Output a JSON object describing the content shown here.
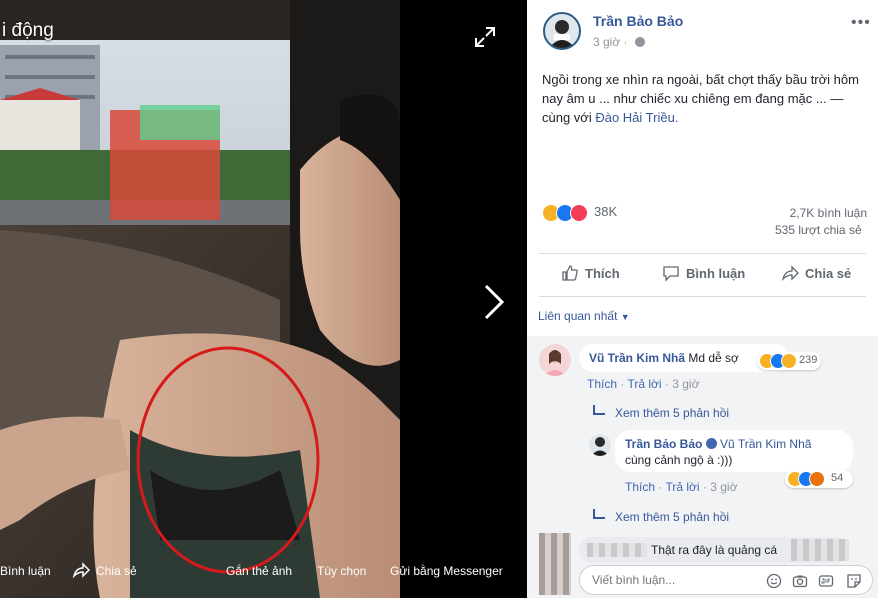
{
  "viewer": {
    "title_fragment": "i động",
    "bar": {
      "comment": "Bình luận",
      "share": "Chia sẻ",
      "tag": "Gắn thẻ ảnh",
      "options": "Tùy chọn",
      "send": "Gửi bằng Messenger"
    }
  },
  "post": {
    "author": "Trần Bảo Bảo",
    "time": "3 giờ",
    "text": "Ngồi trong xe nhìn ra ngoài, bất chợt thấy bầu trời hôm nay âm u ... như chiếc xu chiêng em đang mặc ... — cùng với ",
    "tagged": "Đào Hải Triều.",
    "reactions_count": "38K",
    "comments_count": "2,7K bình luận",
    "shares_count": "535 lượt chia sẻ",
    "actions": {
      "like": "Thích",
      "comment": "Bình luận",
      "share": "Chia sẻ"
    },
    "sort": "Liên quan nhất"
  },
  "comments": [
    {
      "name": "Vũ Trần Kim Nhã",
      "text": "Md dễ sợ",
      "reactions": "239",
      "like": "Thích",
      "reply": "Trả lời",
      "time": "3 giờ"
    },
    {
      "more": "Xem thêm 5 phản hồi",
      "name": "Trần Bảo Bảo",
      "tag": "Vũ Trần Kim Nhã",
      "text": "cùng cảnh ngộ à :)))",
      "reactions": "54",
      "like": "Thích",
      "reply": "Trả lời",
      "time": "3 giờ"
    },
    {
      "more": "Xem thêm 5 phản hồi",
      "text": "Thật ra đây là quảng cá"
    }
  ],
  "composer": {
    "placeholder": "Viết bình luận..."
  },
  "colors": {
    "link": "#365899",
    "reaction_like": "#1877f2",
    "reaction_haha": "#f7b125",
    "reaction_love": "#f33e58",
    "circle": "#d61a1a"
  }
}
